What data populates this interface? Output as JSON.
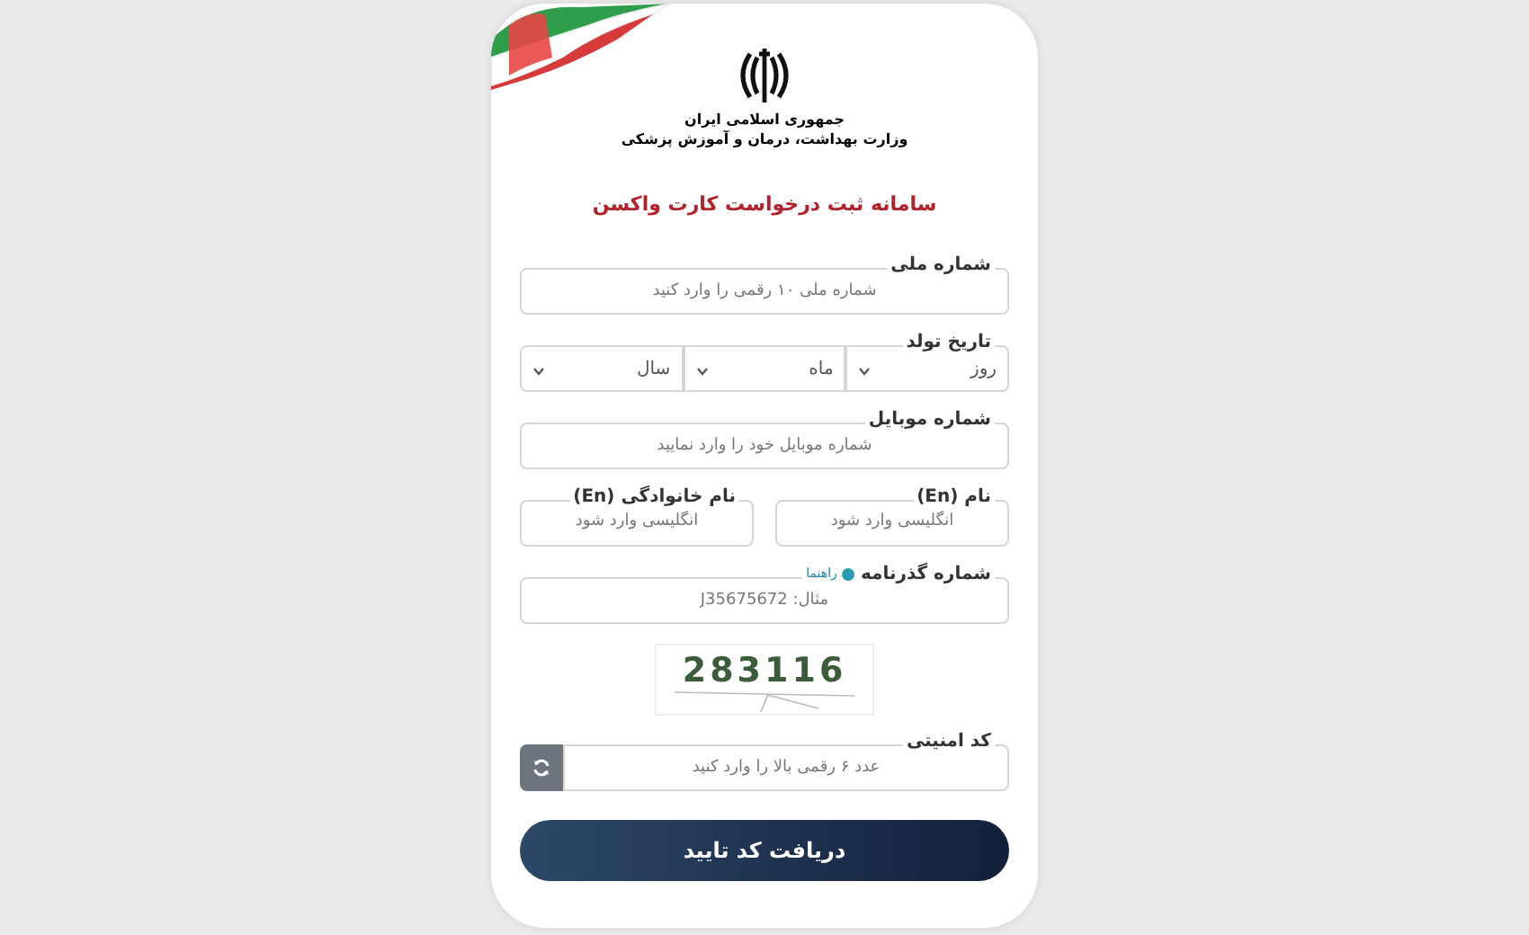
{
  "header": {
    "emblem_line_1": "جمهوری اسلامی ایران",
    "emblem_line_2": "وزارت بهداشت، درمان و آموزش پزشکی",
    "title": "سامانه ثبت درخواست کارت واکسن"
  },
  "fields": [
    {
      "kind": "text",
      "label": "شماره ملی",
      "placeholder": "شماره ملی ۱۰ رقمی را وارد کنید"
    },
    {
      "kind": "date",
      "label": "تاریخ تولد",
      "selects": [
        {
          "value": "روز"
        },
        {
          "value": "ماه"
        },
        {
          "value": "سال"
        }
      ]
    },
    {
      "kind": "text",
      "label": "شماره موبایل",
      "placeholder": "شماره موبایل خود را وارد نمایید"
    },
    {
      "kind": "pair",
      "items": [
        {
          "label": "نام (En)",
          "placeholder": "انگلیسی وارد شود"
        },
        {
          "label": "نام خانوادگی (En)",
          "placeholder": "انگلیسی وارد شود"
        }
      ]
    },
    {
      "kind": "text",
      "label": "شماره گذرنامه",
      "help_link": "راهنما",
      "placeholder": "مثال: J35675672"
    },
    {
      "kind": "captcha",
      "code": "283116"
    },
    {
      "kind": "security",
      "label": "کد امنیتی",
      "placeholder": "عدد ۶ رقمی بالا را وارد کنید"
    }
  ],
  "submit_button": "دریافت کد تایید"
}
